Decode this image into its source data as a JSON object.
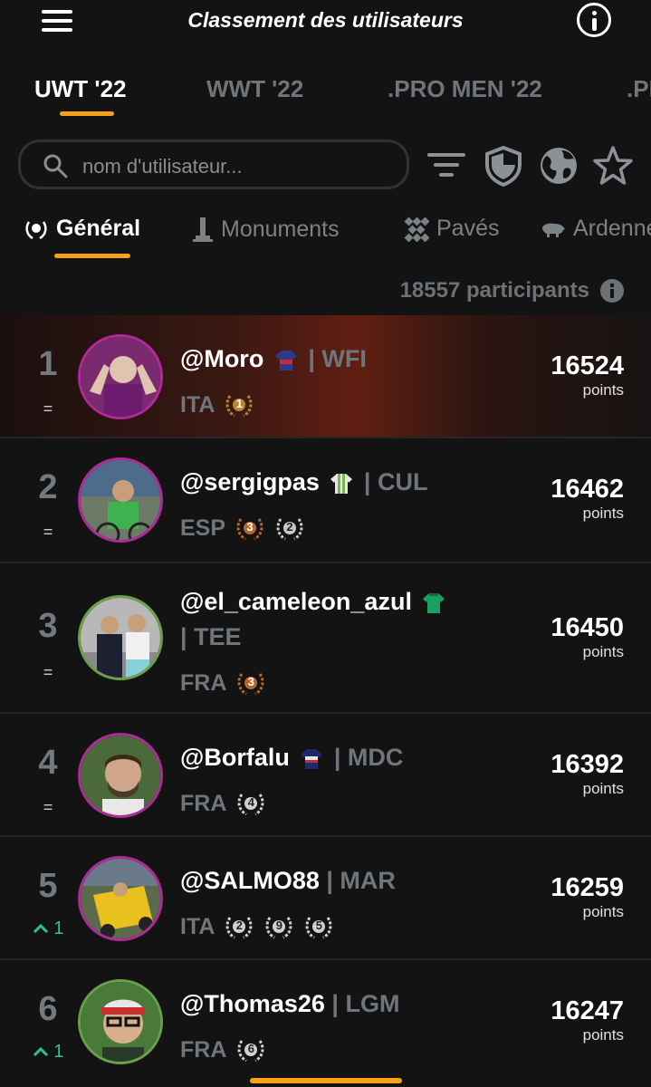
{
  "header": {
    "title": "Classement des utilisateurs"
  },
  "competition_tabs": [
    "UWT '22",
    "WWT '22",
    ".PRO MEN '22",
    ".PRO"
  ],
  "search": {
    "placeholder": "nom d'utilisateur..."
  },
  "tools": [
    "filter-icon",
    "shield-icon",
    "globe-icon",
    "star-icon"
  ],
  "category_tabs": [
    "Général",
    "Monuments",
    "Pavés",
    "Ardennes"
  ],
  "participants": "18557 participants",
  "points_label": "points",
  "rows": [
    {
      "rank": "1",
      "trend": "=",
      "username": "@Moro",
      "team": "| WFI",
      "country": "ITA",
      "score": "16524",
      "badges": [
        {
          "n": "1",
          "color": "#b8862c"
        }
      ]
    },
    {
      "rank": "2",
      "trend": "=",
      "username": "@sergigpas",
      "team": "| CUL",
      "country": "ESP",
      "score": "16462",
      "badges": [
        {
          "n": "3",
          "color": "#b8652c"
        },
        {
          "n": "2",
          "color": "#c8c8c8"
        }
      ]
    },
    {
      "rank": "3",
      "trend": "=",
      "username": "@el_cameleon_azul",
      "team": "| TEE",
      "country": "FRA",
      "score": "16450",
      "badges": [
        {
          "n": "3",
          "color": "#b8652c"
        }
      ]
    },
    {
      "rank": "4",
      "trend": "=",
      "username": "@Borfalu",
      "team": "| MDC",
      "country": "FRA",
      "score": "16392",
      "badges": [
        {
          "n": "4",
          "color": "#d0d0d0"
        }
      ]
    },
    {
      "rank": "5",
      "trend": "1",
      "username": "@SALMO88",
      "team": "| MAR",
      "country": "ITA",
      "score": "16259",
      "badges": [
        {
          "n": "2",
          "color": "#d0d0d0"
        },
        {
          "n": "9",
          "color": "#d0d0d0"
        },
        {
          "n": "5",
          "color": "#d0d0d0"
        }
      ]
    },
    {
      "rank": "6",
      "trend": "1",
      "username": "@Thomas26",
      "team": "| LGM",
      "country": "FRA",
      "score": "16247",
      "badges": [
        {
          "n": "6",
          "color": "#d0d0d0"
        }
      ]
    }
  ],
  "colors": {
    "accent": "#f5a21a",
    "trend_up": "#2ec48e",
    "muted": "#6e767c",
    "background": "#131313"
  }
}
